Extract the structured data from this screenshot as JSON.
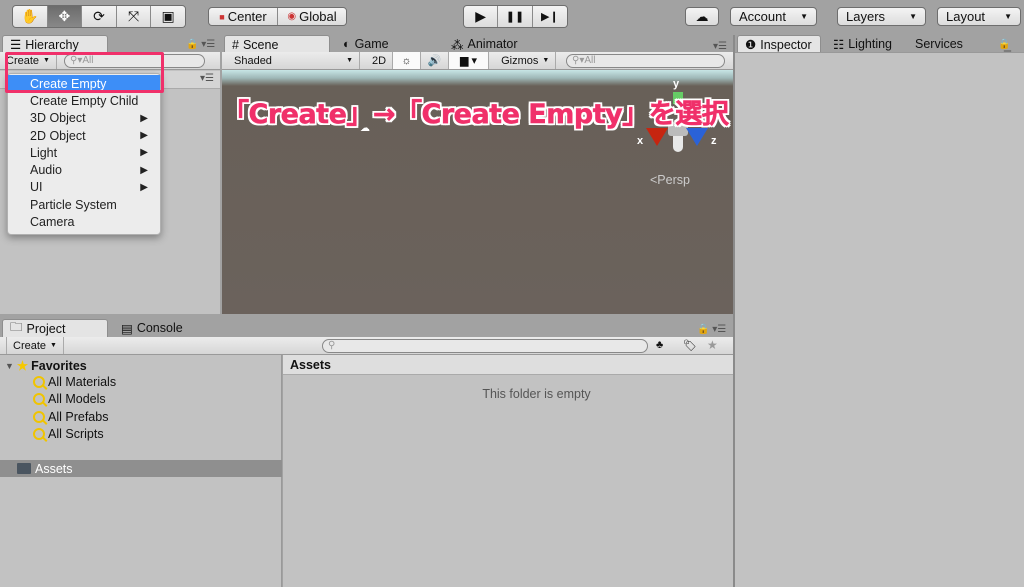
{
  "toolbar": {
    "tools": [
      {
        "icon": "hand-icon",
        "glyph": "✋"
      },
      {
        "icon": "move-icon",
        "glyph": "✥",
        "active": true
      },
      {
        "icon": "rotate-icon",
        "glyph": "⟳"
      },
      {
        "icon": "scale-icon",
        "glyph": "⤧"
      },
      {
        "icon": "rect-icon",
        "glyph": "▣"
      }
    ],
    "pivot": "Center",
    "space": "Global",
    "play": "▶",
    "pause": "❚❚",
    "step": "▶❙",
    "cloud": "☁",
    "account": "Account",
    "layers": "Layers",
    "layout": "Layout"
  },
  "hierarchy": {
    "tab": "Hierarchy",
    "create": "Create",
    "search_placeholder": "All"
  },
  "menu": {
    "items": [
      {
        "label": "Create Empty",
        "highlighted": true,
        "submenu": false
      },
      {
        "label": "Create Empty Child",
        "submenu": false
      },
      {
        "label": "3D Object",
        "submenu": true
      },
      {
        "label": "2D Object",
        "submenu": true
      },
      {
        "label": "Light",
        "submenu": true
      },
      {
        "label": "Audio",
        "submenu": true
      },
      {
        "label": "UI",
        "submenu": true
      },
      {
        "label": "Particle System",
        "submenu": false
      },
      {
        "label": "Camera",
        "submenu": false
      }
    ]
  },
  "scene": {
    "tabs": [
      "Scene",
      "Game",
      "Animator"
    ],
    "shading": "Shaded",
    "mode2d": "2D",
    "gizmos": "Gizmos",
    "search_placeholder": "All",
    "axis_x": "x",
    "axis_y": "y",
    "axis_z": "z",
    "persp": "<Persp"
  },
  "annotation": "「Create」→「Create Empty」を選択",
  "inspector": {
    "tabs": [
      "Inspector",
      "Lighting",
      "Services"
    ]
  },
  "project": {
    "tabs": [
      "Project",
      "Console"
    ],
    "create": "Create",
    "favorites": "Favorites",
    "fav_items": [
      "All Materials",
      "All Models",
      "All Prefabs",
      "All Scripts"
    ],
    "assets": "Assets",
    "assets_header": "Assets",
    "empty": "This folder is empty"
  },
  "colors": {
    "highlight": "#3d8ef7",
    "annotation": "#f0306a"
  }
}
